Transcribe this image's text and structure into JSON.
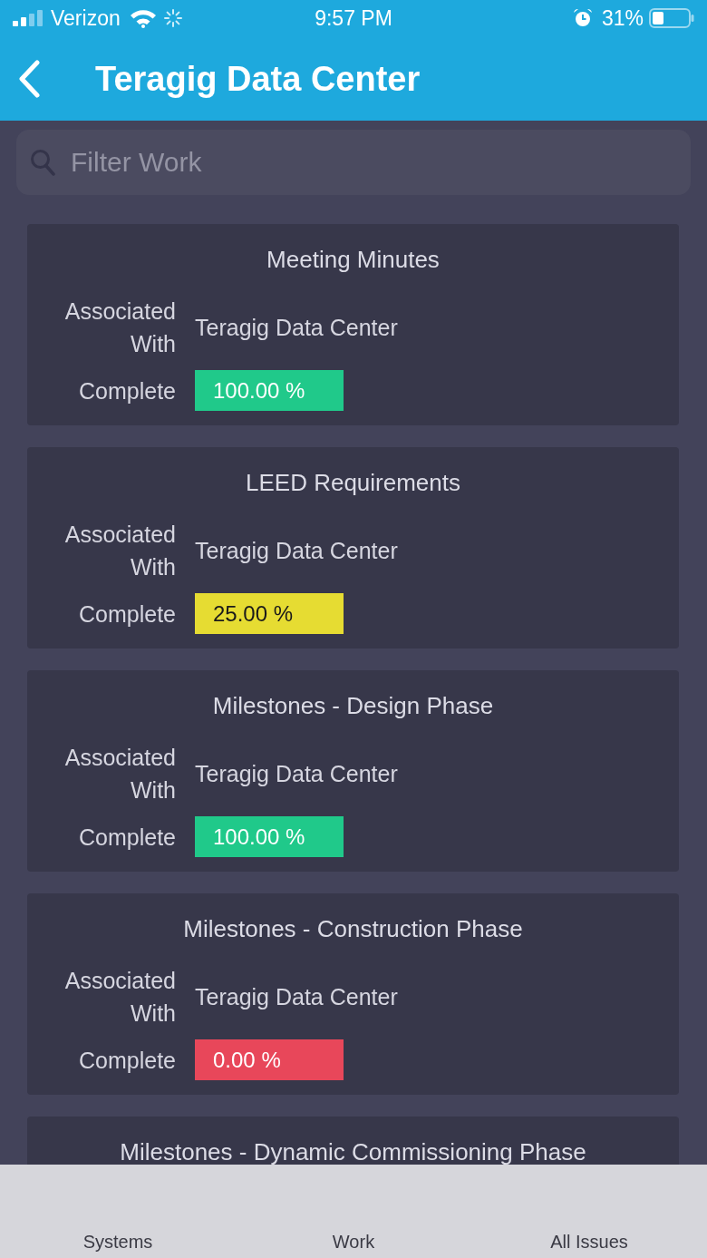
{
  "status_bar": {
    "carrier": "Verizon",
    "time": "9:57 PM",
    "battery": "31%"
  },
  "header": {
    "title": "Teragig Data Center"
  },
  "search": {
    "placeholder": "Filter Work"
  },
  "work_items": [
    {
      "title": "Meeting Minutes",
      "associated_label": "Associated With",
      "associated_value": "Teragig Data Center",
      "complete_label": "Complete",
      "complete_value": "100.00 %",
      "color": "#20c98a"
    },
    {
      "title": "LEED Requirements",
      "associated_label": "Associated With",
      "associated_value": "Teragig Data Center",
      "complete_label": "Complete",
      "complete_value": "25.00 %",
      "color": "#e6dc32"
    },
    {
      "title": "Milestones - Design Phase",
      "associated_label": "Associated With",
      "associated_value": "Teragig Data Center",
      "complete_label": "Complete",
      "complete_value": "100.00 %",
      "color": "#20c98a"
    },
    {
      "title": "Milestones - Construction Phase",
      "associated_label": "Associated With",
      "associated_value": "Teragig Data Center",
      "complete_label": "Complete",
      "complete_value": "0.00 %",
      "color": "#e8475a"
    },
    {
      "title": "Milestones - Dynamic Commissioning Phase"
    }
  ],
  "tab_bar": {
    "tabs": [
      {
        "label": "Systems"
      },
      {
        "label": "Work"
      },
      {
        "label": "All Issues"
      }
    ]
  }
}
